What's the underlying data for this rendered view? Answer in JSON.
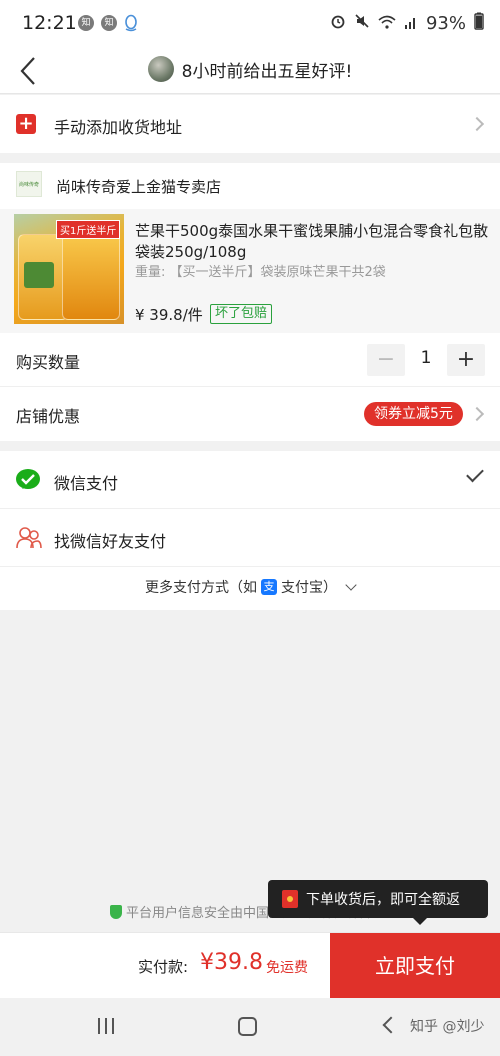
{
  "status_bar": {
    "time": "12:21",
    "badge1": "知",
    "badge2": "知",
    "battery": "93%"
  },
  "header": {
    "title": "8小时前给出五星好评!"
  },
  "address": {
    "label": "手动添加收货地址"
  },
  "shop": {
    "logo_text": "尚味传奇",
    "name": "尚味传奇爱上金猫专卖店"
  },
  "product": {
    "image_tag": "买1斤送半斤",
    "title": "芒果干500g泰国水果干蜜饯果脯小包混合零食礼包散袋装250g/108g",
    "spec": "重量: 【买一送半斤】袋装原味芒果干共2袋",
    "price": "¥ 39.8/件",
    "guarantee": "坏了包赔"
  },
  "quantity": {
    "label": "购买数量",
    "minus": "−",
    "value": "1",
    "plus": "+"
  },
  "discount": {
    "label": "店铺优惠",
    "coupon": "领券立减5元"
  },
  "payment": {
    "wechat": "微信支付",
    "friend": "找微信好友支付",
    "more_prefix": "更多支付方式（如",
    "alipay_icon_text": "支",
    "alipay": "支付宝）"
  },
  "security": {
    "text": "平台用户信息安全由中国人民财产保险保障"
  },
  "tooltip": {
    "text": "下单收货后，即可全额返"
  },
  "bottom": {
    "pay_label": "实付款:",
    "amount": "¥39.8",
    "free_shipping": "免运费",
    "pay_button": "立即支付"
  },
  "watermark": "知乎 @刘少",
  "colors": {
    "accent": "#e0312a",
    "wechat_green": "#1aad19",
    "guarantee_green": "#2aa13d",
    "alipay_blue": "#1678ff"
  }
}
